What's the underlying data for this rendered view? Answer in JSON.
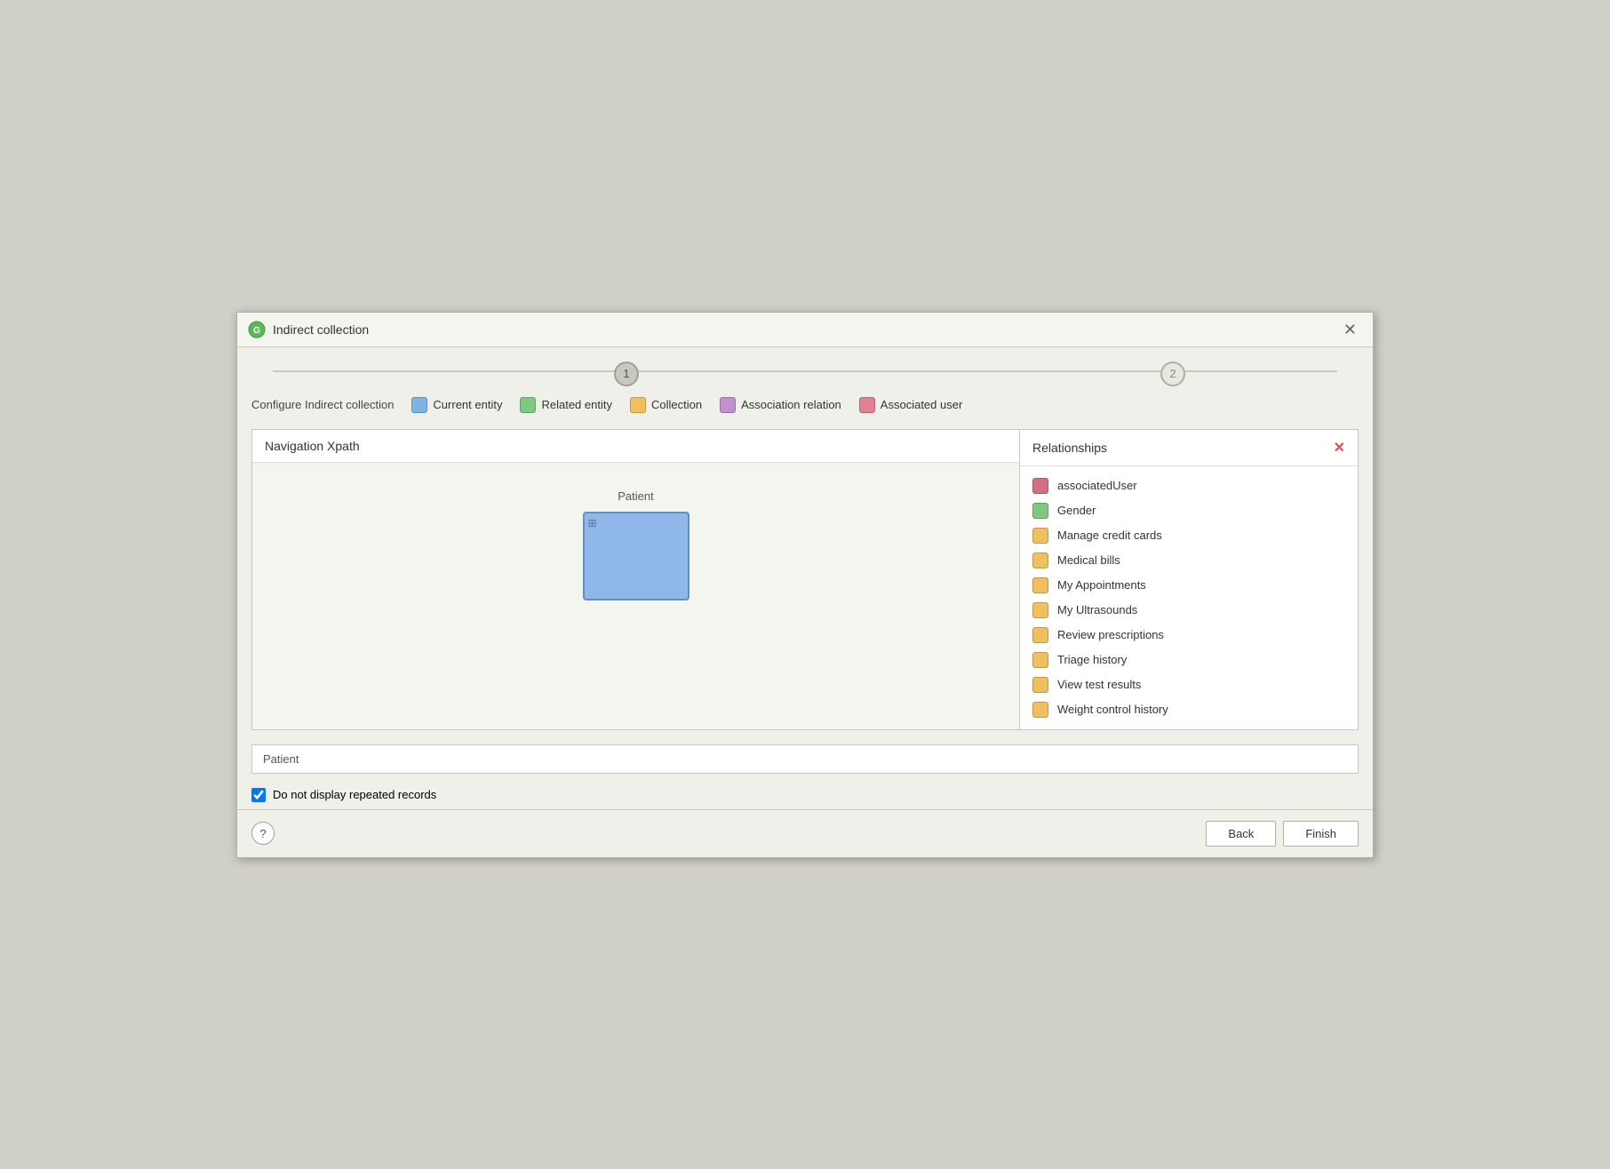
{
  "dialog": {
    "title": "Indirect collection",
    "logo_color": "#5cb85c"
  },
  "steps": {
    "step1": "1",
    "step2": "2"
  },
  "legend": {
    "title": "Configure Indirect collection",
    "items": [
      {
        "id": "current-entity",
        "label": "Current entity",
        "color": "#7db4e8"
      },
      {
        "id": "related-entity",
        "label": "Related entity",
        "color": "#80c880"
      },
      {
        "id": "collection",
        "label": "Collection",
        "color": "#f0c060"
      },
      {
        "id": "association-relation",
        "label": "Association relation",
        "color": "#c090d0"
      },
      {
        "id": "associated-user",
        "label": "Associated user",
        "color": "#e08090"
      }
    ]
  },
  "nav_xpath": {
    "header": "Navigation Xpath",
    "patient_label": "Patient"
  },
  "relationships": {
    "header": "Relationships",
    "items": [
      {
        "id": "associatedUser",
        "label": "associatedUser",
        "color": "#d07080"
      },
      {
        "id": "Gender",
        "label": "Gender",
        "color": "#80c880"
      },
      {
        "id": "ManageCreditCards",
        "label": "Manage credit cards",
        "color": "#f0c060"
      },
      {
        "id": "MedicalBills",
        "label": "Medical bills",
        "color": "#f0c060"
      },
      {
        "id": "MyAppointments",
        "label": "My Appointments",
        "color": "#f0c060"
      },
      {
        "id": "MyUltrasounds",
        "label": "My Ultrasounds",
        "color": "#f0c060"
      },
      {
        "id": "ReviewPrescriptions",
        "label": "Review prescriptions",
        "color": "#f0c060"
      },
      {
        "id": "TriageHistory",
        "label": "Triage history",
        "color": "#f0c060"
      },
      {
        "id": "ViewTestResults",
        "label": "View test results",
        "color": "#f0c060"
      },
      {
        "id": "WeightControlHistory",
        "label": "Weight control history",
        "color": "#f0c060"
      }
    ]
  },
  "xpath_display": {
    "value": "Patient"
  },
  "checkbox": {
    "label": "Do not display repeated records",
    "checked": true
  },
  "footer": {
    "back_label": "Back",
    "finish_label": "Finish",
    "help_label": "?"
  }
}
